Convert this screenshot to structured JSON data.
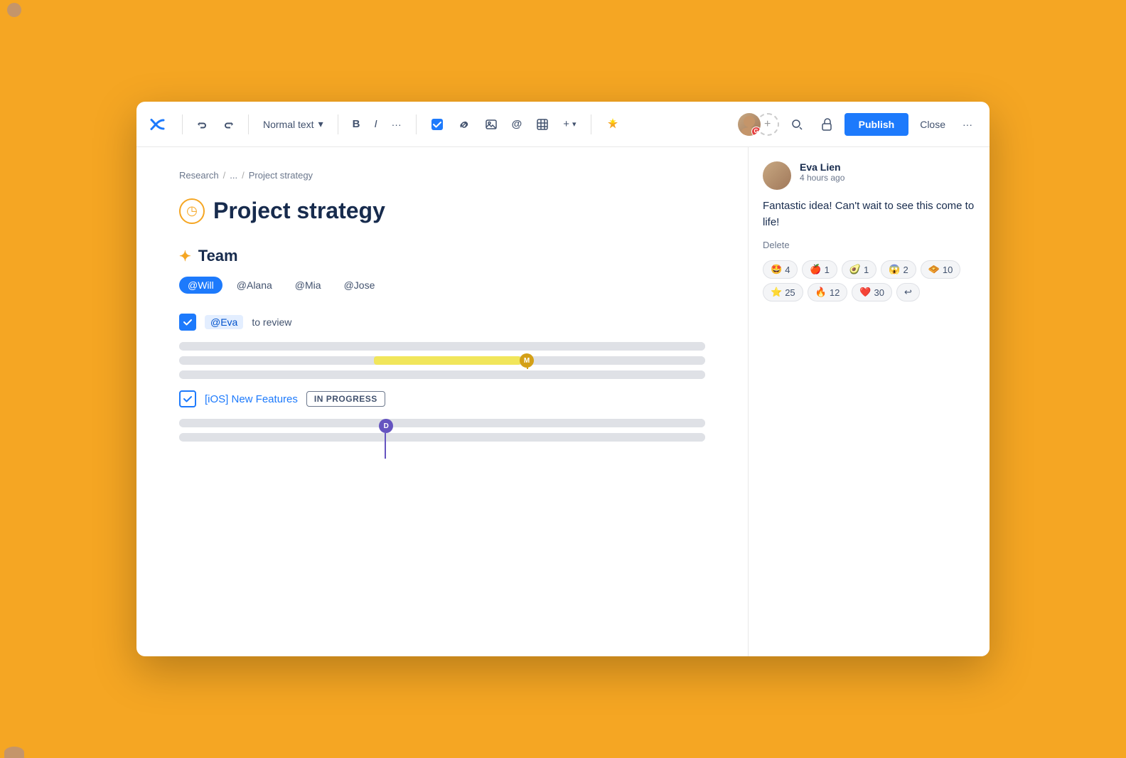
{
  "app": {
    "logo": "✕",
    "title": "Project strategy"
  },
  "toolbar": {
    "undo_label": "↩",
    "redo_label": "↪",
    "text_style_label": "Normal text",
    "text_style_chevron": "▾",
    "bold_label": "B",
    "italic_label": "I",
    "more_label": "···",
    "task_label": "☑",
    "link_label": "🔗",
    "image_label": "⬛",
    "mention_label": "@",
    "table_label": "⊞",
    "insert_label": "+▾",
    "ai_label": "✳",
    "search_label": "🔍",
    "lock_label": "🔒",
    "publish_label": "Publish",
    "close_label": "Close",
    "more_options_label": "···"
  },
  "breadcrumb": {
    "items": [
      "Research",
      "/",
      "...",
      "/",
      "Project strategy"
    ]
  },
  "page": {
    "icon": "◷",
    "title": "Project strategy"
  },
  "team_section": {
    "icon": "✦",
    "heading": "Team",
    "members": [
      "@Will",
      "@Alana",
      "@Mia",
      "@Jose"
    ]
  },
  "task1": {
    "mention": "@Eva",
    "text": "to review"
  },
  "ios_task": {
    "label": "[iOS] New Features",
    "badge": "IN PROGRESS"
  },
  "comment": {
    "author": "Eva Lien",
    "time": "4 hours ago",
    "text": "Fantastic idea! Can't wait to see this come to life!",
    "delete_label": "Delete",
    "reactions": [
      {
        "emoji": "🤩",
        "count": "4"
      },
      {
        "emoji": "🍎",
        "count": "1"
      },
      {
        "emoji": "🥑",
        "count": "1"
      },
      {
        "emoji": "😱",
        "count": "2"
      },
      {
        "emoji": "🧇",
        "count": "10"
      }
    ],
    "reactions2": [
      {
        "emoji": "🌟",
        "count": "25"
      },
      {
        "emoji": "🔥",
        "count": "12"
      },
      {
        "emoji": "❤️",
        "count": "30"
      },
      {
        "emoji": "↩",
        "count": ""
      }
    ]
  },
  "cursors": {
    "m_label": "M",
    "d_label": "D"
  }
}
